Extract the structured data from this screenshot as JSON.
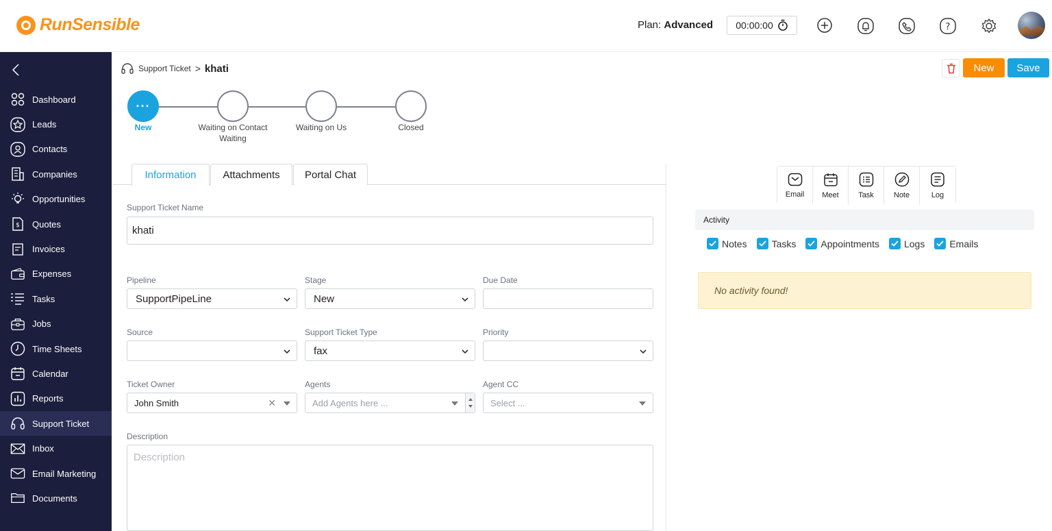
{
  "brand": {
    "name": "RunSensible",
    "color": "#f7941d"
  },
  "header": {
    "plan_label": "Plan:",
    "plan_value": "Advanced",
    "timer": "00:00:00",
    "icons": [
      "add-timer-icon",
      "bell-icon",
      "phone-icon",
      "help-icon",
      "gear-icon"
    ]
  },
  "sidebar": {
    "items": [
      {
        "label": "Dashboard",
        "icon": "dashboard-icon"
      },
      {
        "label": "Leads",
        "icon": "star-icon"
      },
      {
        "label": "Contacts",
        "icon": "contact-icon"
      },
      {
        "label": "Companies",
        "icon": "building-icon"
      },
      {
        "label": "Opportunities",
        "icon": "lightbulb-icon"
      },
      {
        "label": "Quotes",
        "icon": "quote-icon"
      },
      {
        "label": "Invoices",
        "icon": "invoice-icon"
      },
      {
        "label": "Expenses",
        "icon": "wallet-icon"
      },
      {
        "label": "Tasks",
        "icon": "tasks-icon"
      },
      {
        "label": "Jobs",
        "icon": "briefcase-icon"
      },
      {
        "label": "Time Sheets",
        "icon": "clock-icon"
      },
      {
        "label": "Calendar",
        "icon": "calendar-icon"
      },
      {
        "label": "Reports",
        "icon": "report-icon"
      },
      {
        "label": "Support Ticket",
        "icon": "headset-icon",
        "active": true
      },
      {
        "label": "Inbox",
        "icon": "inbox-icon"
      },
      {
        "label": "Email Marketing",
        "icon": "email-marketing-icon"
      },
      {
        "label": "Documents",
        "icon": "folder-icon"
      }
    ]
  },
  "breadcrumb": {
    "parent": "Support Ticket",
    "current": "khati"
  },
  "actions": {
    "new_label": "New",
    "save_label": "Save"
  },
  "stepper": {
    "steps": [
      {
        "label": "New",
        "active": true
      },
      {
        "label": "Waiting on Contact Waiting"
      },
      {
        "label": "Waiting on Us"
      },
      {
        "label": "Closed"
      }
    ]
  },
  "tabs": [
    {
      "label": "Information",
      "active": true
    },
    {
      "label": "Attachments"
    },
    {
      "label": "Portal Chat"
    }
  ],
  "form": {
    "name_label": "Support Ticket Name",
    "name_value": "khati",
    "pipeline_label": "Pipeline",
    "pipeline_value": "SupportPipeLine",
    "stage_label": "Stage",
    "stage_value": "New",
    "due_label": "Due Date",
    "due_value": "",
    "source_label": "Source",
    "source_value": "",
    "type_label": "Support Ticket Type",
    "type_value": "fax",
    "priority_label": "Priority",
    "priority_value": "",
    "owner_label": "Ticket Owner",
    "owner_value": "John Smith",
    "agents_label": "Agents",
    "agents_placeholder": "Add Agents here ...",
    "agentcc_label": "Agent CC",
    "agentcc_placeholder": "Select ...",
    "description_label": "Description",
    "description_placeholder": "Description"
  },
  "activity": {
    "toolbar": [
      {
        "label": "Email",
        "icon": "email-icon"
      },
      {
        "label": "Meet",
        "icon": "meet-calendar-icon"
      },
      {
        "label": "Task",
        "icon": "task-list-icon"
      },
      {
        "label": "Note",
        "icon": "note-pen-icon"
      },
      {
        "label": "Log",
        "icon": "log-icon"
      }
    ],
    "title": "Activity",
    "filters": [
      "Notes",
      "Tasks",
      "Appointments",
      "Logs",
      "Emails"
    ],
    "empty_message": "No activity found!"
  }
}
